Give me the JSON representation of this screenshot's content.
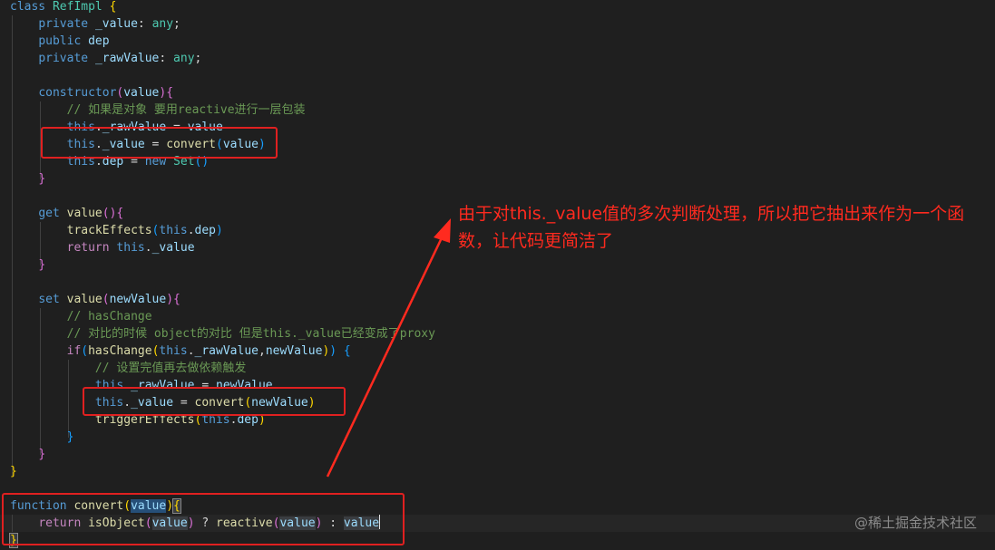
{
  "code": {
    "class_keyword": "class",
    "class_name": "RefImpl",
    "private_kw": "private",
    "public_kw": "public",
    "field_value": "_value",
    "field_dep": "dep",
    "field_raw": "_rawValue",
    "type_any": "any",
    "constructor_name": "constructor",
    "param_value": "value",
    "comment_wrap": "// 如果是对象 要用reactive进行一层包装",
    "this_kw": "this",
    "convert_fn": "convert",
    "new_kw": "new",
    "set_cls": "Set",
    "get_kw": "get",
    "set_kw": "set",
    "value_name": "value",
    "track_fn": "trackEffects",
    "return_kw": "return",
    "new_value": "newValue",
    "comment_haschange": "// hasChange",
    "comment_compare": "// 对比的时候 object的对比 但是this._value已经变成了proxy",
    "if_kw": "if",
    "haschange_fn": "hasChange",
    "comment_set": "// 设置完值再去做依赖触发",
    "trigger_fn": "triggerEffects",
    "function_kw": "function",
    "isobject_fn": "isObject",
    "reactive_fn": "reactive"
  },
  "annotation": {
    "text": "由于对this._value值的多次判断处理，所以把它抽出来作为一个函数，让代码更简洁了",
    "color": "#ff2a1f"
  },
  "watermark": "@稀土掘金技术社区",
  "colors": {
    "background": "#1f1f1f",
    "keyword": "#569cd6",
    "control": "#c586c0",
    "class": "#4ec9b0",
    "function": "#dcdcaa",
    "variable": "#9cdcfe",
    "comment": "#6a9955",
    "highlight_box": "#e02020"
  }
}
